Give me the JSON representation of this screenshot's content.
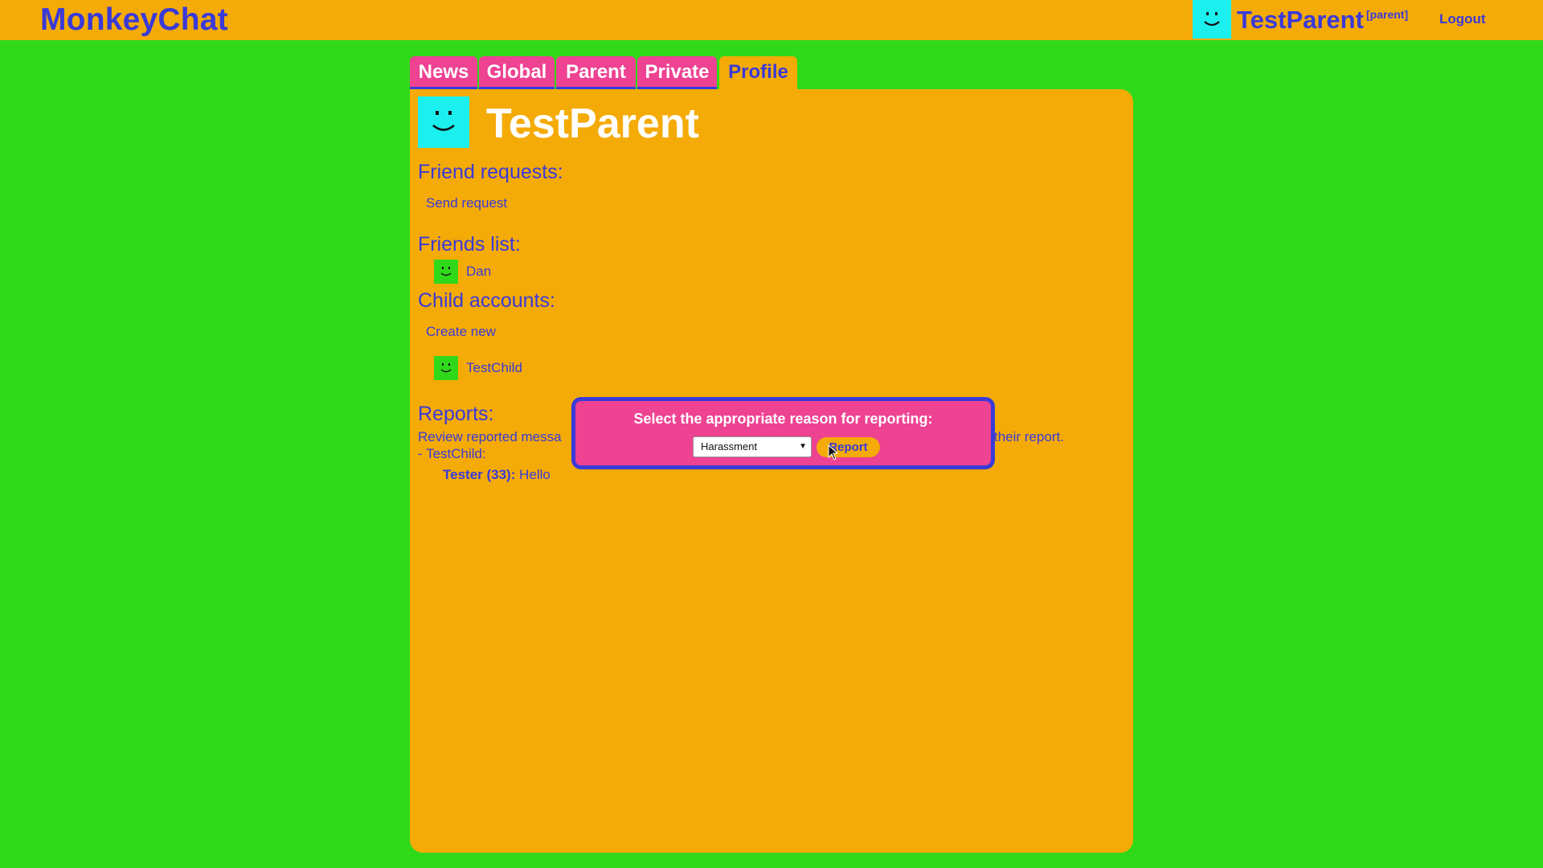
{
  "app": {
    "brand": "MonkeyChat",
    "colors": {
      "background": "#2fd91a",
      "bar": "#f4ab07",
      "accent": "#3a3ad8",
      "tab": "#ee4292",
      "avatar": "#1cf0ee"
    }
  },
  "header": {
    "username": "TestParent",
    "role": "[parent]",
    "logout_label": "Logout"
  },
  "tabs": [
    {
      "label": "News"
    },
    {
      "label": "Global"
    },
    {
      "label": "Parent"
    },
    {
      "label": "Private"
    },
    {
      "label": "Profile",
      "active": true
    }
  ],
  "profile": {
    "name": "TestParent",
    "friend_requests_heading": "Friend requests:",
    "send_request_label": "Send request",
    "friends_heading": "Friends list:",
    "friends": [
      {
        "name": "Dan"
      }
    ],
    "child_heading": "Child accounts:",
    "create_new_label": "Create new",
    "children": [
      {
        "name": "TestChild"
      }
    ],
    "reports_heading": "Reports:",
    "reports_intro_start": "Review reported messa",
    "reports_intro_end": "their report.",
    "report_child": "- TestChild:",
    "report_message": {
      "user": "Tester (33):",
      "text": "Hello"
    }
  },
  "modal": {
    "title": "Select the appropriate reason for reporting:",
    "selected_reason": "Harassment",
    "report_button": "Report"
  }
}
